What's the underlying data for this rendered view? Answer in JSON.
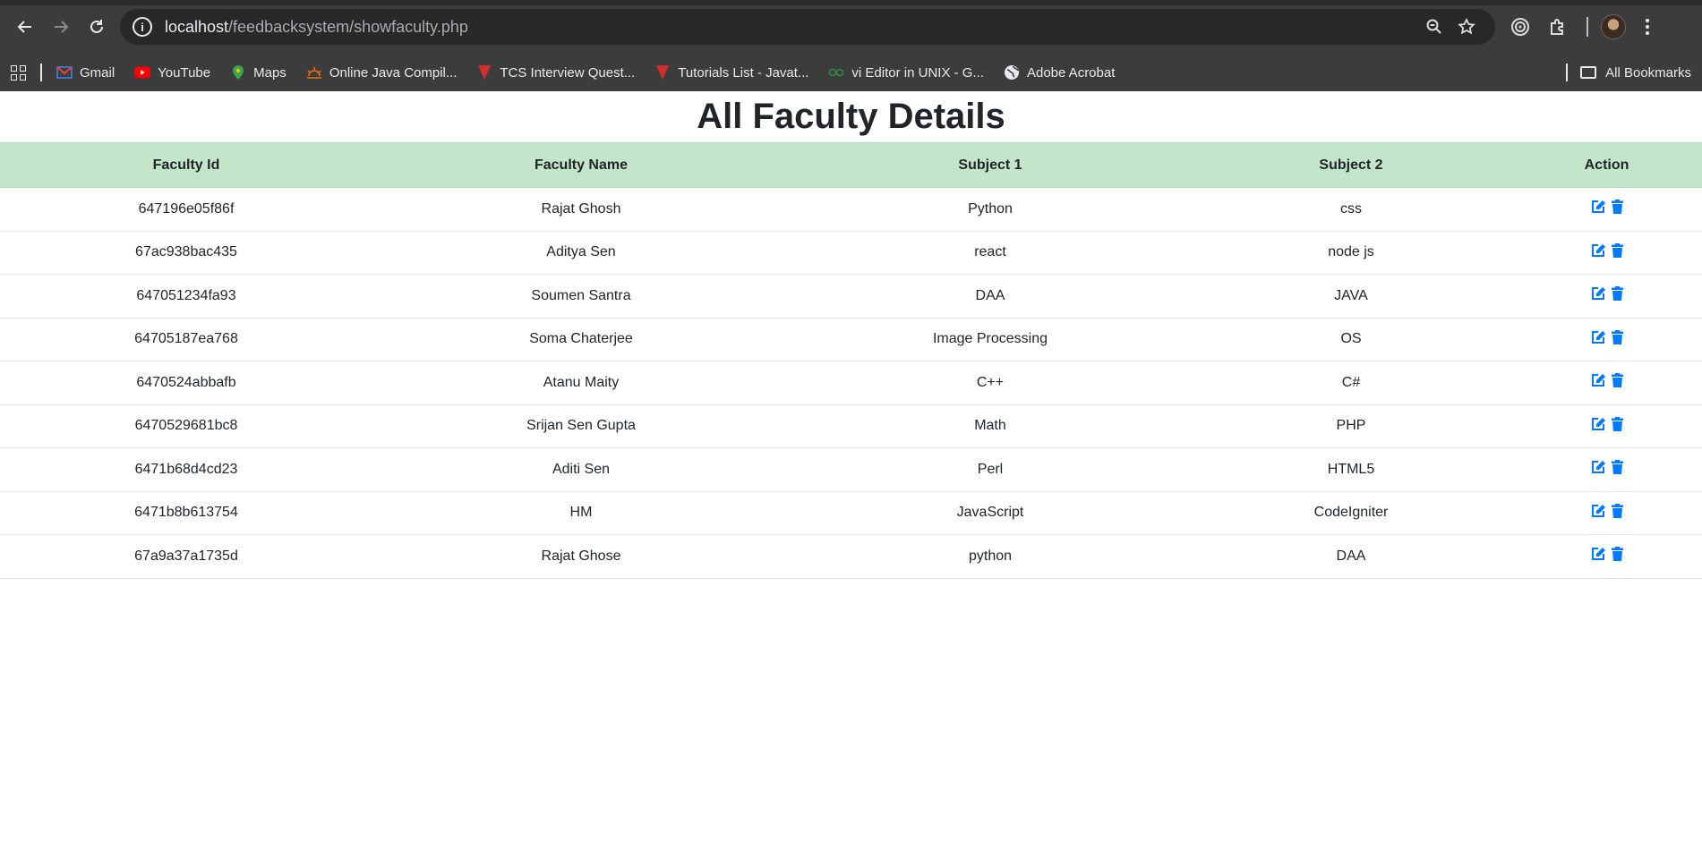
{
  "browser": {
    "url_host": "localhost",
    "url_path": "/feedbacksystem/showfaculty.php",
    "bookmarks": [
      {
        "label": "Gmail",
        "icon": "gmail-icon",
        "color": "#ea4335"
      },
      {
        "label": "YouTube",
        "icon": "youtube-icon",
        "color": "#ff0000"
      },
      {
        "label": "Maps",
        "icon": "maps-icon",
        "color": "#34a853"
      },
      {
        "label": "Online Java Compil...",
        "icon": "sun-icon",
        "color": "#e8710a"
      },
      {
        "label": "TCS Interview Quest...",
        "icon": "javatpoint-icon",
        "color": "#d32f2f"
      },
      {
        "label": "Tutorials List - Javat...",
        "icon": "javatpoint-icon",
        "color": "#d32f2f"
      },
      {
        "label": "vi Editor in UNIX - G...",
        "icon": "geeks-icon",
        "color": "#2f8d46"
      },
      {
        "label": "Adobe Acrobat",
        "icon": "globe-icon",
        "color": "#e8eaed"
      }
    ],
    "all_bookmarks_label": "All Bookmarks"
  },
  "page": {
    "title": "All Faculty Details",
    "columns": [
      "Faculty Id",
      "Faculty Name",
      "Subject 1",
      "Subject 2",
      "Action"
    ],
    "rows": [
      {
        "id": "647196e05f86f",
        "name": "Rajat Ghosh",
        "subject1": "Python",
        "subject2": "css"
      },
      {
        "id": "67ac938bac435",
        "name": "Aditya Sen",
        "subject1": "react",
        "subject2": "node js"
      },
      {
        "id": "647051234fa93",
        "name": "Soumen Santra",
        "subject1": "DAA",
        "subject2": "JAVA"
      },
      {
        "id": "64705187ea768",
        "name": "Soma Chaterjee",
        "subject1": "Image Processing",
        "subject2": "OS"
      },
      {
        "id": "6470524abbafb",
        "name": "Atanu Maity",
        "subject1": "C++",
        "subject2": "C#"
      },
      {
        "id": "6470529681bc8",
        "name": "Srijan Sen Gupta",
        "subject1": "Math",
        "subject2": "PHP"
      },
      {
        "id": "6471b68d4cd23",
        "name": "Aditi Sen",
        "subject1": "Perl",
        "subject2": "HTML5"
      },
      {
        "id": "6471b8b613754",
        "name": "HM",
        "subject1": "JavaScript",
        "subject2": "CodeIgniter"
      },
      {
        "id": "67a9a37a1735d",
        "name": "Rajat Ghose",
        "subject1": "python",
        "subject2": "DAA"
      }
    ],
    "action_icons": [
      "edit-icon",
      "trash-icon"
    ],
    "accent_color": "#007bff",
    "header_bg": "#c3e6cb"
  }
}
